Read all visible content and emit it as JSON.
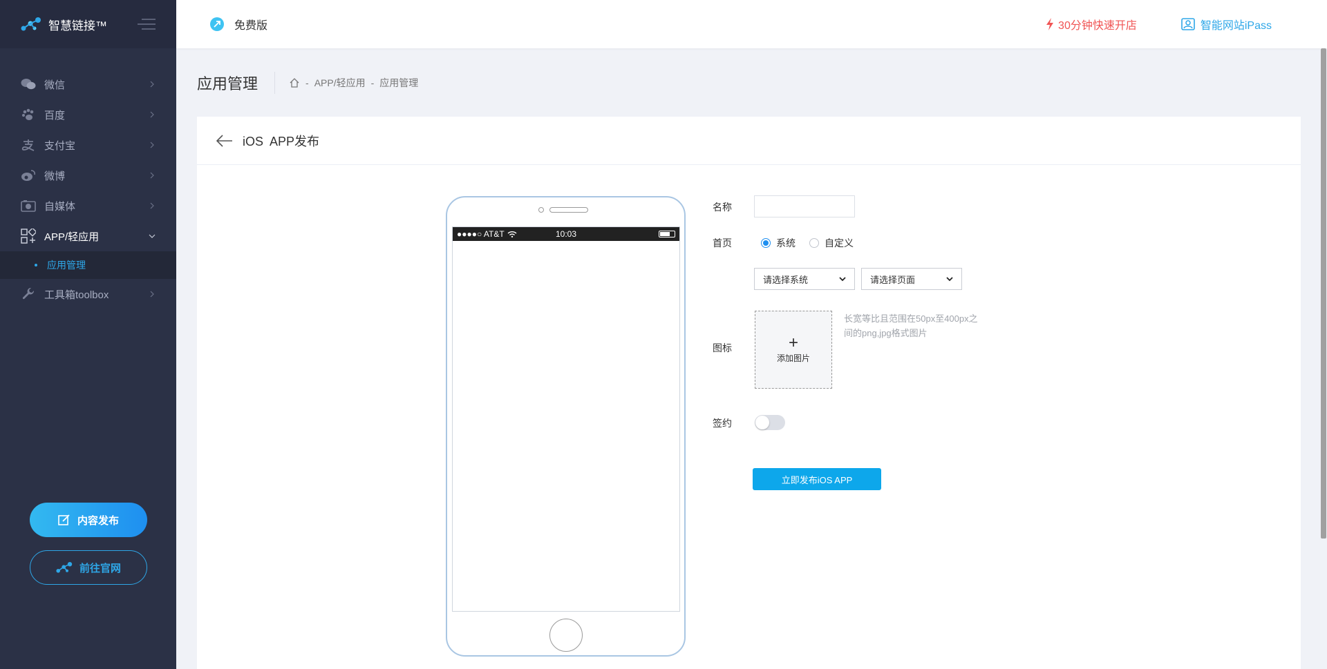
{
  "app": {
    "logo_text": "智慧链接™"
  },
  "sidebar": {
    "items": [
      {
        "label": "微信",
        "icon": "wechat-icon"
      },
      {
        "label": "百度",
        "icon": "paw-icon"
      },
      {
        "label": "支付宝",
        "icon": "alipay-icon"
      },
      {
        "label": "微博",
        "icon": "weibo-icon"
      },
      {
        "label": "自媒体",
        "icon": "media-icon"
      },
      {
        "label": "APP/轻应用",
        "icon": "apps-icon",
        "expanded": true
      },
      {
        "label": "工具箱toolbox",
        "icon": "wrench-icon"
      }
    ],
    "sub_items": [
      {
        "label": "应用管理"
      }
    ],
    "publish_label": "内容发布",
    "site_label": "前往官网"
  },
  "header": {
    "version_label": "免费版",
    "fast_open_label": "30分钟快速开店",
    "ipass_label": "智能网站iPass"
  },
  "page": {
    "title": "应用管理",
    "breadcrumb": [
      "APP/轻应用",
      "应用管理"
    ],
    "breadcrumb_sep": "-",
    "card_title": "iOS  APP发布"
  },
  "phone": {
    "carrier": "●●●●○ AT&T",
    "time": "10:03"
  },
  "form": {
    "name_label": "名称",
    "name_value": "",
    "home_label": "首页",
    "home_options": [
      "系统",
      "自定义"
    ],
    "home_selected": "系统",
    "select_system": "请选择系统",
    "select_page": "请选择页面",
    "icon_label": "图标",
    "upload_plus": "+",
    "upload_text": "添加图片",
    "upload_hint": "长宽等比且范围在50px至400px之间的png,jpg格式图片",
    "sign_label": "签约",
    "sign_on": false,
    "submit_label": "立即发布iOS APP"
  },
  "colors": {
    "accent": "#1e8ff0",
    "sidebar_bg": "#2b3146",
    "alert_red": "#f05454",
    "link_blue": "#2ea7e8"
  }
}
